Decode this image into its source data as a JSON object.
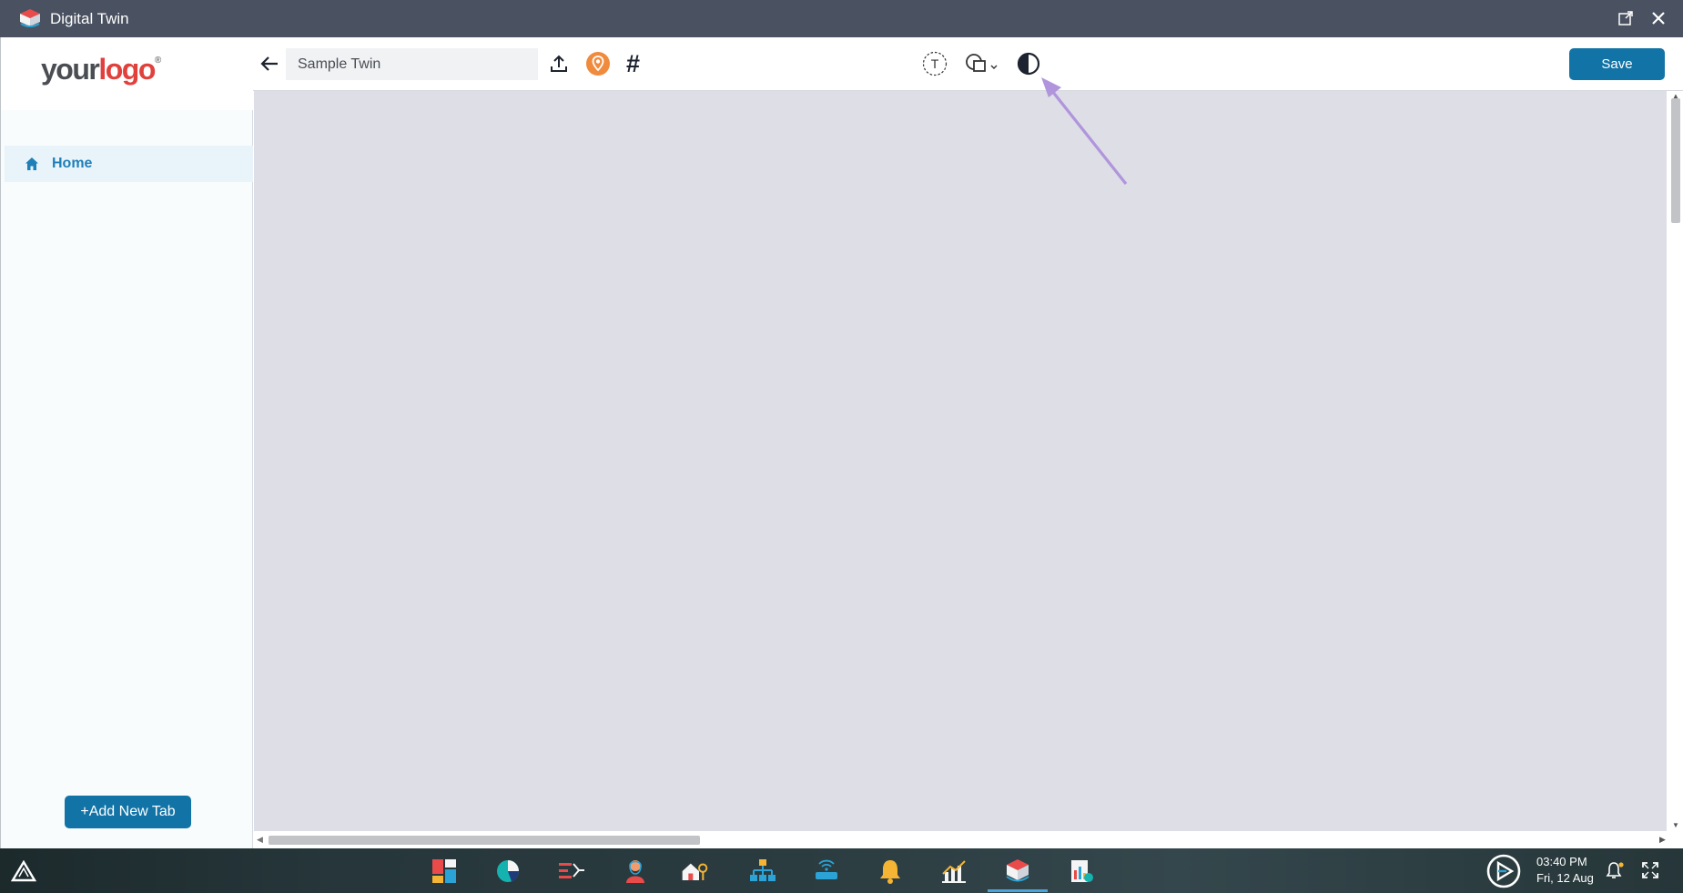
{
  "window": {
    "title": "Digital Twin"
  },
  "sidebar": {
    "logo": {
      "part1": "your",
      "part2": "logo",
      "mark": "®"
    },
    "nav": [
      {
        "label": "Home",
        "icon": "home-icon"
      }
    ],
    "add_tab_label": "+Add New Tab"
  },
  "toolbar": {
    "name_value": "Sample Twin",
    "text_tool_letter": "T",
    "hash_symbol": "#",
    "save_label": "Save"
  },
  "taskbar": {
    "time": "03:40 PM",
    "date": "Fri, 12 Aug"
  },
  "colors": {
    "accent": "#1274a6",
    "titlebar": "#4a5160",
    "canvas": "#dddee6",
    "annotation_arrow": "#b095dc"
  }
}
